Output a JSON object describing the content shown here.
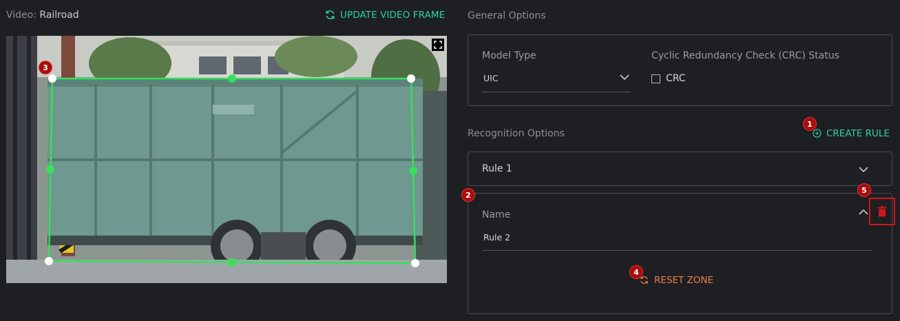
{
  "header": {
    "video_label": "Video:",
    "video_name": "Railroad",
    "update_button": "UPDATE VIDEO FRAME"
  },
  "general_options": {
    "title": "General Options",
    "model_type_label": "Model Type",
    "model_type_value": "UIC",
    "crc_label": "Cyclic Redundancy Check (CRC) Status",
    "crc_checkbox_label": "CRC",
    "crc_checked": false
  },
  "recognition_options": {
    "title": "Recognition Options",
    "create_rule": "CREATE RULE",
    "rules": [
      {
        "label": "Rule 1",
        "expanded": false
      },
      {
        "name_label": "Name",
        "name_value": "Rule 2",
        "expanded": true,
        "reset_zone": "RESET ZONE"
      }
    ]
  },
  "badges": [
    "1",
    "2",
    "3",
    "4",
    "5"
  ],
  "colors": {
    "accent": "#2fd1a4",
    "reset": "#ee7f45",
    "danger": "#d0161b",
    "zone": "#36e05b",
    "background": "#1e1f23"
  },
  "icons": [
    "refresh-icon",
    "fullscreen-icon",
    "chevron-down-icon",
    "chevron-up-icon",
    "plus-circle-icon",
    "reset-icon",
    "trash-icon"
  ]
}
